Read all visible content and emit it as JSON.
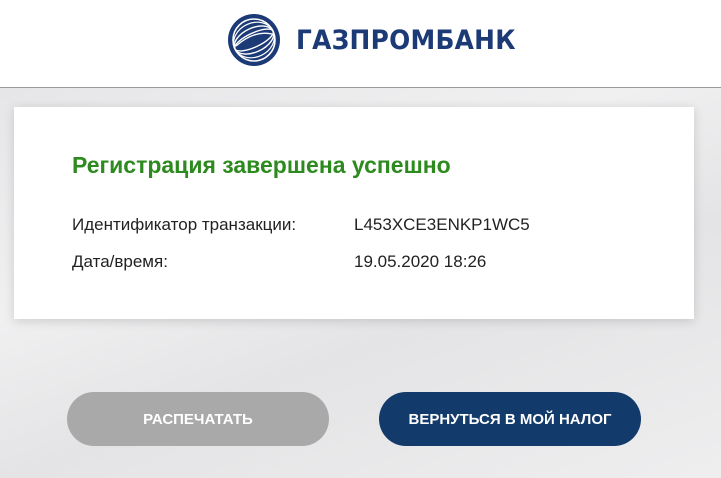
{
  "header": {
    "brand_name": "ГАЗПРОМБАНК",
    "logo_icon": "gazprombank-logo-icon",
    "brand_color": "#1b3a76"
  },
  "result_card": {
    "title": "Регистрация завершена успешно",
    "title_color": "#2d8a1e",
    "rows": [
      {
        "label": "Идентификатор транзакции:",
        "value": "L453XCE3ENKP1WC5"
      },
      {
        "label": "Дата/время:",
        "value": "19.05.2020 18:26"
      }
    ]
  },
  "actions": {
    "print_label": "РАСПЕЧАТАТЬ",
    "print_color": "#a9a9a9",
    "back_label": "ВЕРНУТЬСЯ В МОЙ НАЛОГ",
    "back_color": "#123a6b"
  }
}
